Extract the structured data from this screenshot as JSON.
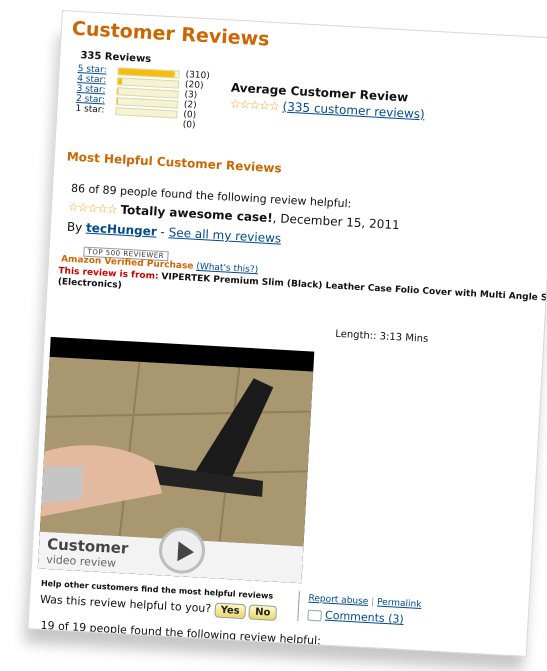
{
  "reviews_header": {
    "title": "Customer Reviews",
    "total_reviews_label": "335 Reviews"
  },
  "histogram": [
    {
      "label": "5 star:",
      "count": "(310)",
      "fraction": 0.925
    },
    {
      "label": "4 star:",
      "count": "(20)",
      "fraction": 0.06
    },
    {
      "label": "3 star:",
      "count": "(3)",
      "fraction": 0.01
    },
    {
      "label": "2 star:",
      "count": "(2)",
      "fraction": 0.006
    },
    {
      "label": "1 star:",
      "count": "(0)",
      "fraction": 0.0
    }
  ],
  "average": {
    "title": "Average Customer Review",
    "stars": "☆☆☆☆☆",
    "link": "(335 customer reviews)"
  },
  "helpful_section": {
    "title": "Most Helpful Customer Reviews"
  },
  "review": {
    "helpful_count": "86 of 89 people found the following review helpful:",
    "stars": "☆☆☆☆☆",
    "title": "Totally awesome case!",
    "date": ", December 15, 2011",
    "by": "By",
    "author": "tecHunger",
    "separator": "-",
    "see_all": "See all my reviews",
    "badge": "TOP 500 REVIEWER",
    "verified": "Amazon Verified Purchase",
    "whats_this": "(What's this?)",
    "from_label": "This review is from:",
    "from_product": "VIPERTEK Premium Slim (Black) Leather Case Folio Cover with Multi Angle Sta",
    "from_category": "(Electronics)",
    "video_length": "Length:: 3:13 Mins",
    "video_title": "Customer",
    "video_subtitle": "video review"
  },
  "feedback": {
    "prompt_small": "Help other customers find the most helpful reviews",
    "question": "Was this review helpful to you?",
    "yes": "Yes",
    "no": "No",
    "report": "Report abuse",
    "divider": "|",
    "permalink": "Permalink",
    "comments": "Comments (3)"
  },
  "next_review": {
    "helpful_count": "19 of 19 people found the following review helpful:"
  },
  "colors": {
    "section_title": "#cc6600",
    "link": "#004b91",
    "bar_fill": "#f8bd0c",
    "star": "#f0a000"
  }
}
